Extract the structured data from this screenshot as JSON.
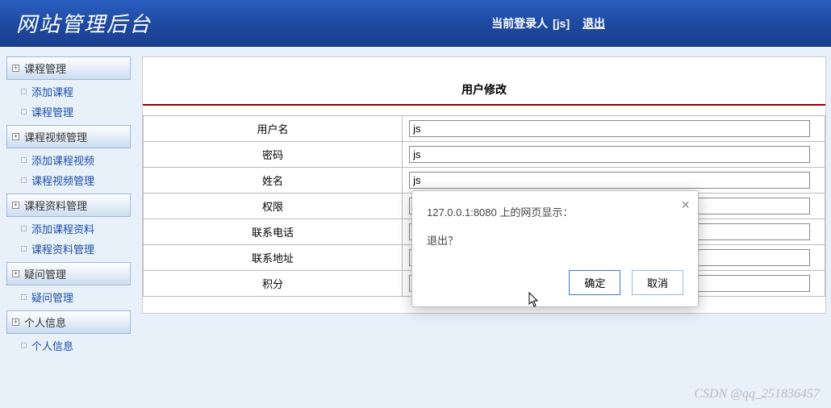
{
  "header": {
    "title": "网站管理后台",
    "login_label": "当前登录人",
    "user": "[js]",
    "logout": "退出"
  },
  "sidebar": {
    "groups": [
      {
        "header": "课程管理",
        "items": [
          "添加课程",
          "课程管理"
        ]
      },
      {
        "header": "课程视频管理",
        "items": [
          "添加课程视频",
          "课程视频管理"
        ]
      },
      {
        "header": "课程资料管理",
        "items": [
          "添加课程资料",
          "课程资料管理"
        ]
      },
      {
        "header": "疑问管理",
        "items": [
          "疑问管理"
        ]
      },
      {
        "header": "个人信息",
        "items": [
          "个人信息"
        ]
      }
    ]
  },
  "panel": {
    "title": "用户修改",
    "rows": [
      {
        "label": "用户名",
        "value": "js"
      },
      {
        "label": "密码",
        "value": "js"
      },
      {
        "label": "姓名",
        "value": "js"
      },
      {
        "label": "权限",
        "value": ""
      },
      {
        "label": "联系电话",
        "value": ""
      },
      {
        "label": "联系地址",
        "value": ""
      },
      {
        "label": "积分",
        "value": ""
      }
    ]
  },
  "modal": {
    "title": "127.0.0.1:8080 上的网页显示：",
    "message": "退出？",
    "ok": "确定",
    "cancel": "取消"
  },
  "watermark": "CSDN @qq_251836457"
}
